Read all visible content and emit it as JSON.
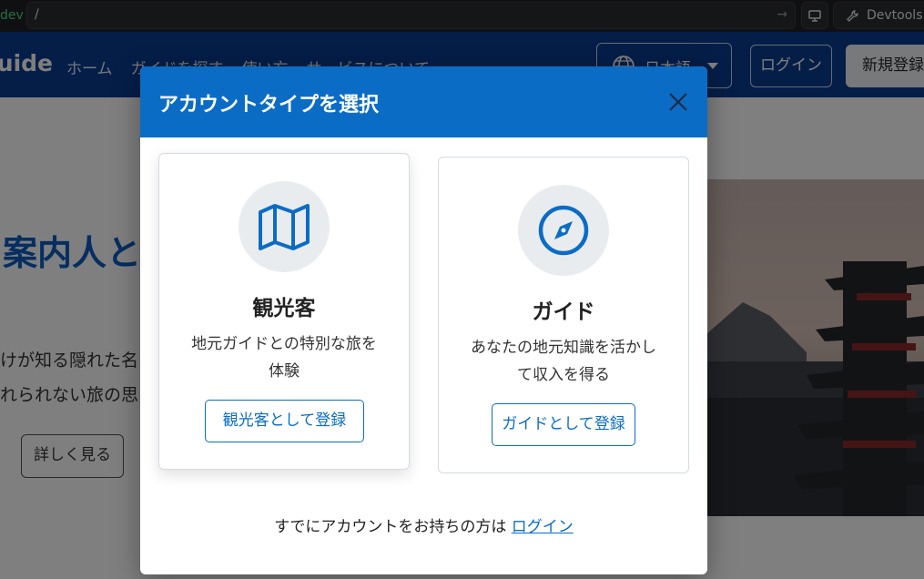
{
  "browser": {
    "env_label": "dev",
    "url": "/",
    "devtools_label": "Devtools"
  },
  "nav": {
    "brand": "Guide",
    "links": [
      "ホーム",
      "ガイドを探す",
      "使い方",
      "サービスについて"
    ],
    "language": "日本語",
    "login": "ログイン",
    "signup": "新規登録"
  },
  "hero": {
    "title_fragment": "の案内人と",
    "line1_fragment": "けが知る隠れた名",
    "line2_fragment": "れられない旅の思",
    "details_button": "詳しく見る"
  },
  "modal": {
    "title": "アカウントタイプを選択",
    "cards": [
      {
        "id": "tourist",
        "icon": "map-icon",
        "title": "観光客",
        "description": "地元ガイドとの特別な旅を体験",
        "button": "観光客として登録"
      },
      {
        "id": "guide",
        "icon": "compass-icon",
        "title": "ガイド",
        "description": "あなたの地元知識を活かして収入を得る",
        "button": "ガイドとして登録"
      }
    ],
    "footer_text": "すでにアカウントをお持ちの方は",
    "footer_link": "ログイン"
  },
  "colors": {
    "accent": "#0b6cc6",
    "nav_bg": "#0a3d91",
    "icon_circle_bg": "#e9ecef"
  }
}
